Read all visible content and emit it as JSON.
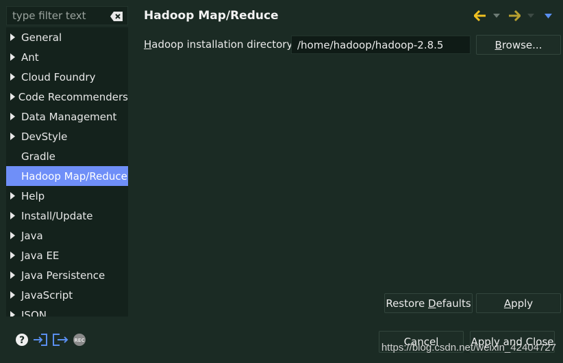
{
  "filter": {
    "placeholder": "type filter text"
  },
  "tree": {
    "items": [
      {
        "label": "General",
        "expandable": true
      },
      {
        "label": "Ant",
        "expandable": true
      },
      {
        "label": "Cloud Foundry",
        "expandable": true
      },
      {
        "label": "Code Recommenders",
        "expandable": true
      },
      {
        "label": "Data Management",
        "expandable": true
      },
      {
        "label": "DevStyle",
        "expandable": true
      },
      {
        "label": "Gradle",
        "expandable": false
      },
      {
        "label": "Hadoop Map/Reduce",
        "expandable": false,
        "selected": true
      },
      {
        "label": "Help",
        "expandable": true
      },
      {
        "label": "Install/Update",
        "expandable": true
      },
      {
        "label": "Java",
        "expandable": true
      },
      {
        "label": "Java EE",
        "expandable": true
      },
      {
        "label": "Java Persistence",
        "expandable": true
      },
      {
        "label": "JavaScript",
        "expandable": true
      },
      {
        "label": "JSON",
        "expandable": true
      }
    ]
  },
  "page": {
    "title": "Hadoop Map/Reduce",
    "dir_label_mnemonic": "H",
    "dir_label_rest": "adoop installation directory:",
    "dir_value": "/home/hadoop/hadoop-2.8.5",
    "browse_mnemonic": "B",
    "browse_rest": "rowse..."
  },
  "buttons": {
    "restore_pre": "Restore ",
    "restore_mnemonic": "D",
    "restore_post": "efaults",
    "apply_mnemonic": "A",
    "apply_rest": "pply",
    "cancel": "Cancel",
    "apply_close": "Apply and Close"
  },
  "watermark": "https://blog.csdn.net/weixin_42404727",
  "colors": {
    "background": "#1b2b24",
    "tree_background": "#14221c",
    "selection": "#6f8ff8",
    "nav_back_arrow": "#f0c020",
    "nav_forward_arrow": "#b8a030",
    "import_export_icon": "#5a8ff0"
  },
  "icons": [
    "clear-filter-icon",
    "back-arrow-icon",
    "forward-arrow-icon",
    "view-menu-icon",
    "help-icon",
    "import-icon",
    "export-icon",
    "record-icon"
  ]
}
